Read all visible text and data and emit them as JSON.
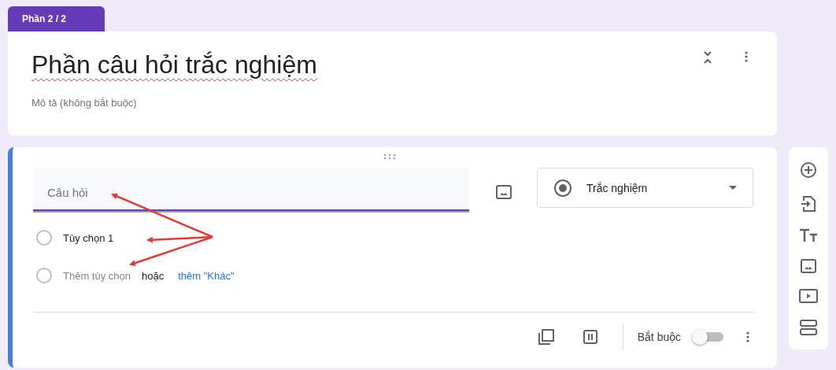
{
  "section_tab": {
    "label": "Phần 2 / 2"
  },
  "header": {
    "title": "Phần câu hỏi trắc nghiệm",
    "description_placeholder": "Mô tả (không bắt buộc)"
  },
  "question": {
    "placeholder": "Câu hỏi",
    "type_select": {
      "label": "Trắc nghiệm"
    },
    "options": [
      {
        "label": "Tùy chọn 1"
      }
    ],
    "add_option": {
      "label": "Thêm tùy chọn",
      "or": "hoặc",
      "add_other": "thêm \"Khác\""
    },
    "required": {
      "label": "Bắt buộc",
      "on": false
    }
  }
}
